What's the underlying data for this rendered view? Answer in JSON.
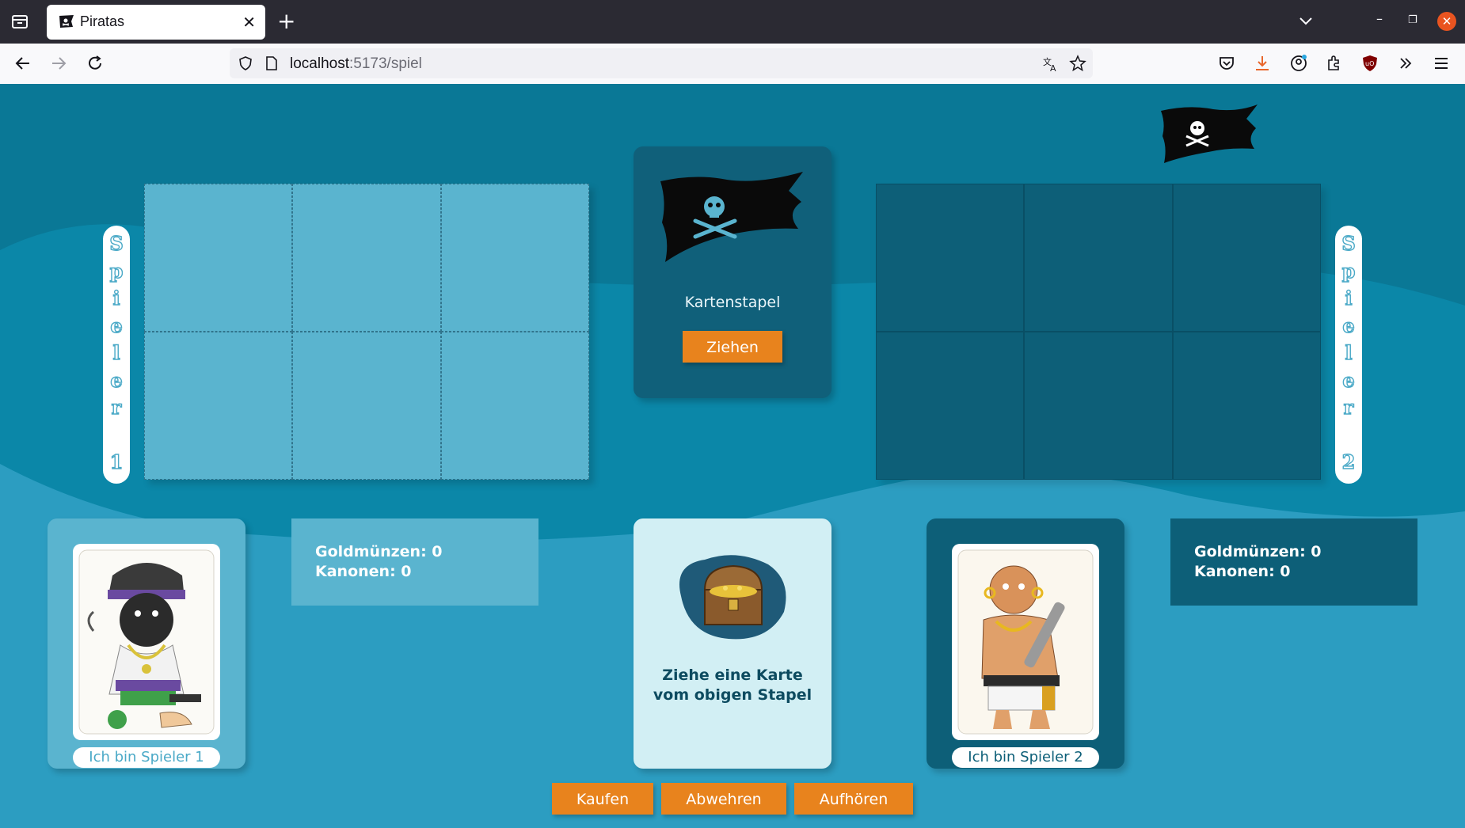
{
  "browser": {
    "tab_title": "Piratas",
    "url_host": "localhost",
    "url_path": ":5173/spiel"
  },
  "game": {
    "players": [
      {
        "vertical_label": [
          "S",
          "p",
          "i",
          "e",
          "l",
          "e",
          "r",
          "",
          "1"
        ],
        "name": "Ich bin Spieler 1",
        "gold_label": "Goldmünzen: 0",
        "cannons_label": "Kanonen: 0"
      },
      {
        "vertical_label": [
          "S",
          "p",
          "i",
          "e",
          "l",
          "e",
          "r",
          "",
          "2"
        ],
        "name": "Ich bin Spieler 2",
        "gold_label": "Goldmünzen: 0",
        "cannons_label": "Kanonen: 0"
      }
    ],
    "deck": {
      "title": "Kartenstapel",
      "draw_button": "Ziehen"
    },
    "hint": {
      "line1": "Ziehe eine Karte",
      "line2": "vom obigen Stapel"
    },
    "actions": {
      "buy": "Kaufen",
      "defend": "Abwehren",
      "stop": "Aufhören"
    },
    "active_player": 2
  },
  "colors": {
    "page_bg": "#0a7896",
    "player1": "#5ab4cf",
    "player2": "#0d5f78",
    "button": "#e8831d",
    "hint_card": "#d2eff4"
  }
}
